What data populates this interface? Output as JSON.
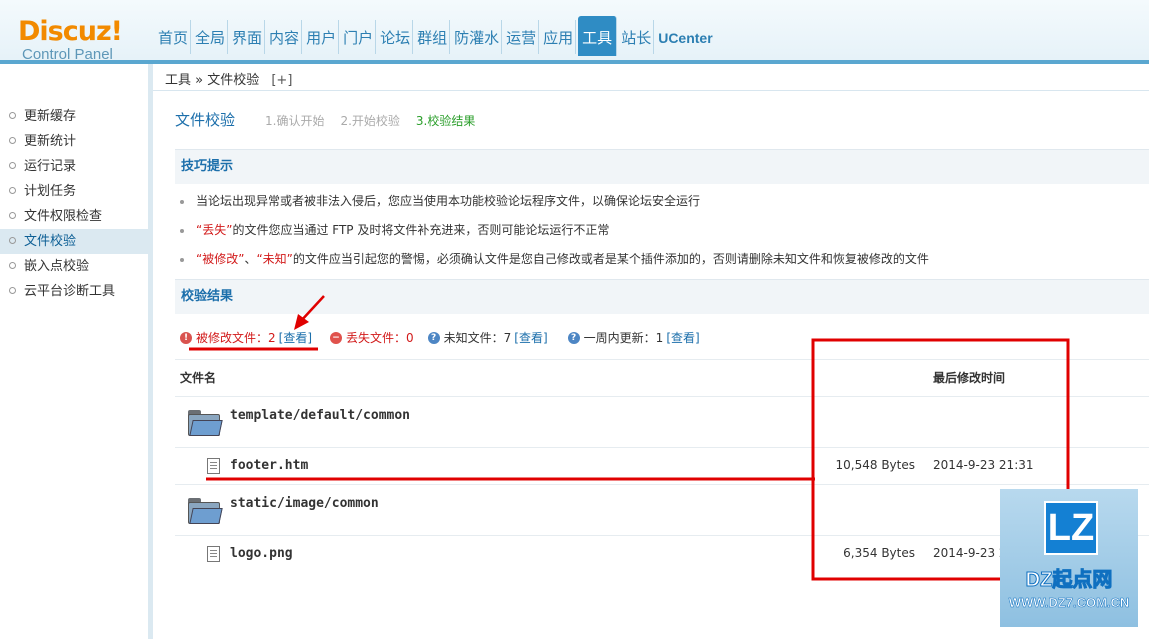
{
  "header": {
    "brand": "Discuz!",
    "brand_sub": "Control Panel",
    "nav": [
      "首页",
      "全局",
      "界面",
      "内容",
      "用户",
      "门户",
      "论坛",
      "群组",
      "防灌水",
      "运营",
      "应用",
      "工具",
      "站长",
      "UCenter"
    ],
    "active_nav": "工具"
  },
  "breadcrumb": {
    "text": "工具 » 文件校验",
    "add": "[+]"
  },
  "sidebar": {
    "items": [
      "更新缓存",
      "更新统计",
      "运行记录",
      "计划任务",
      "文件权限检查",
      "文件校验",
      "嵌入点校验",
      "云平台诊断工具"
    ],
    "active": "文件校验"
  },
  "main": {
    "title": "文件校验",
    "steps": [
      "1.确认开始",
      "2.开始校验",
      "3.校验结果"
    ],
    "tips_title": "技巧提示",
    "tip1": "当论坛出现异常或者被非法入侵后，您应当使用本功能校验论坛程序文件，以确保论坛安全运行",
    "tip2_red": "“丢失”",
    "tip2_rest": "的文件您应当通过 FTP 及时将文件补充进来，否则可能论坛运行不正常",
    "tip3_red1": "“被修改”",
    "tip3_sep": "、",
    "tip3_red2": "“未知”",
    "tip3_rest": "的文件应当引起您的警惕，必须确认文件是您自己修改或者是某个插件添加的，否则请删除未知文件和恢复被修改的文件",
    "result_title": "校验结果",
    "summary": {
      "modified": "被修改文件：2",
      "missing": "丢失文件：0",
      "unknown": "未知文件：7",
      "recent": "一周内更新：1",
      "view": "[查看]"
    },
    "table": {
      "col_name": "文件名",
      "col_time": "最后修改时间",
      "rows": [
        {
          "type": "dir",
          "name": "template/default/common"
        },
        {
          "type": "file",
          "name": "footer.htm",
          "size": "10,548 Bytes",
          "time": "2014-9-23 21:31"
        },
        {
          "type": "dir",
          "name": "static/image/common"
        },
        {
          "type": "file",
          "name": "logo.png",
          "size": "6,354 Bytes",
          "time": "2014-9-23 21:34"
        }
      ]
    }
  },
  "watermark": {
    "logo": "LZ",
    "name": "DZ起点网",
    "url": "WWW.DZ7.COM.CN"
  },
  "colors": {
    "accent": "#2f8cc4",
    "brand": "#f28a00",
    "alert": "#d21a1a",
    "annotation": "#e00000"
  }
}
